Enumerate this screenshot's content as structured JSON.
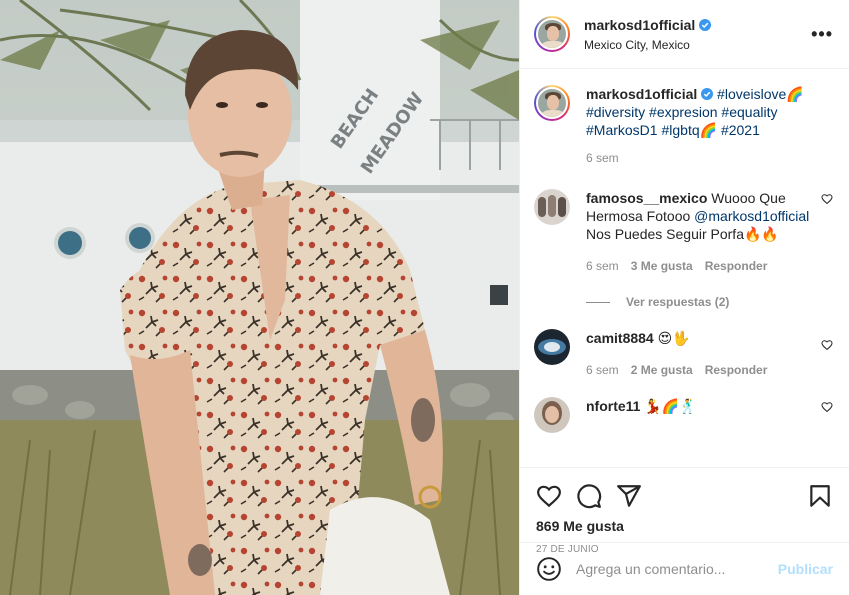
{
  "header": {
    "username": "markosd1official",
    "location": "Mexico City, Mexico",
    "more_label": "•••"
  },
  "caption": {
    "username": "markosd1official",
    "text_parts": [
      "#loveislove🌈",
      "#diversity",
      "#expresion",
      "#equality",
      "#MarkosD1",
      "#lgbtq🌈",
      "#2021"
    ],
    "time": "6 sem"
  },
  "comments": [
    {
      "username": "famosos__mexico",
      "text_a": "Wuooo Que Hermosa Fotooo",
      "mention": "@markosd1official",
      "text_b": "Nos Puedes Seguir Porfa🔥🔥",
      "time": "6 sem",
      "likes": "3 Me gusta",
      "reply": "Responder",
      "view_replies": "Ver respuestas (2)"
    },
    {
      "username": "camit8884",
      "text": "😍🖖",
      "time": "6 sem",
      "likes": "2 Me gusta",
      "reply": "Responder"
    },
    {
      "username": "nforte11",
      "text": "💃🌈🕺"
    }
  ],
  "actions": {
    "likes": "869 Me gusta",
    "date": "27 DE JUNIO"
  },
  "add_comment": {
    "placeholder": "Agrega un comentario...",
    "publish_label": "Publicar"
  },
  "icons": [
    "verified-badge-icon",
    "heart-icon",
    "comment-icon",
    "share-icon",
    "bookmark-icon",
    "emoji-icon"
  ],
  "colors": {
    "link": "#00376b",
    "verified": "#3897f0",
    "publish_disabled": "#b2dffc",
    "muted": "#8e8e8e"
  }
}
